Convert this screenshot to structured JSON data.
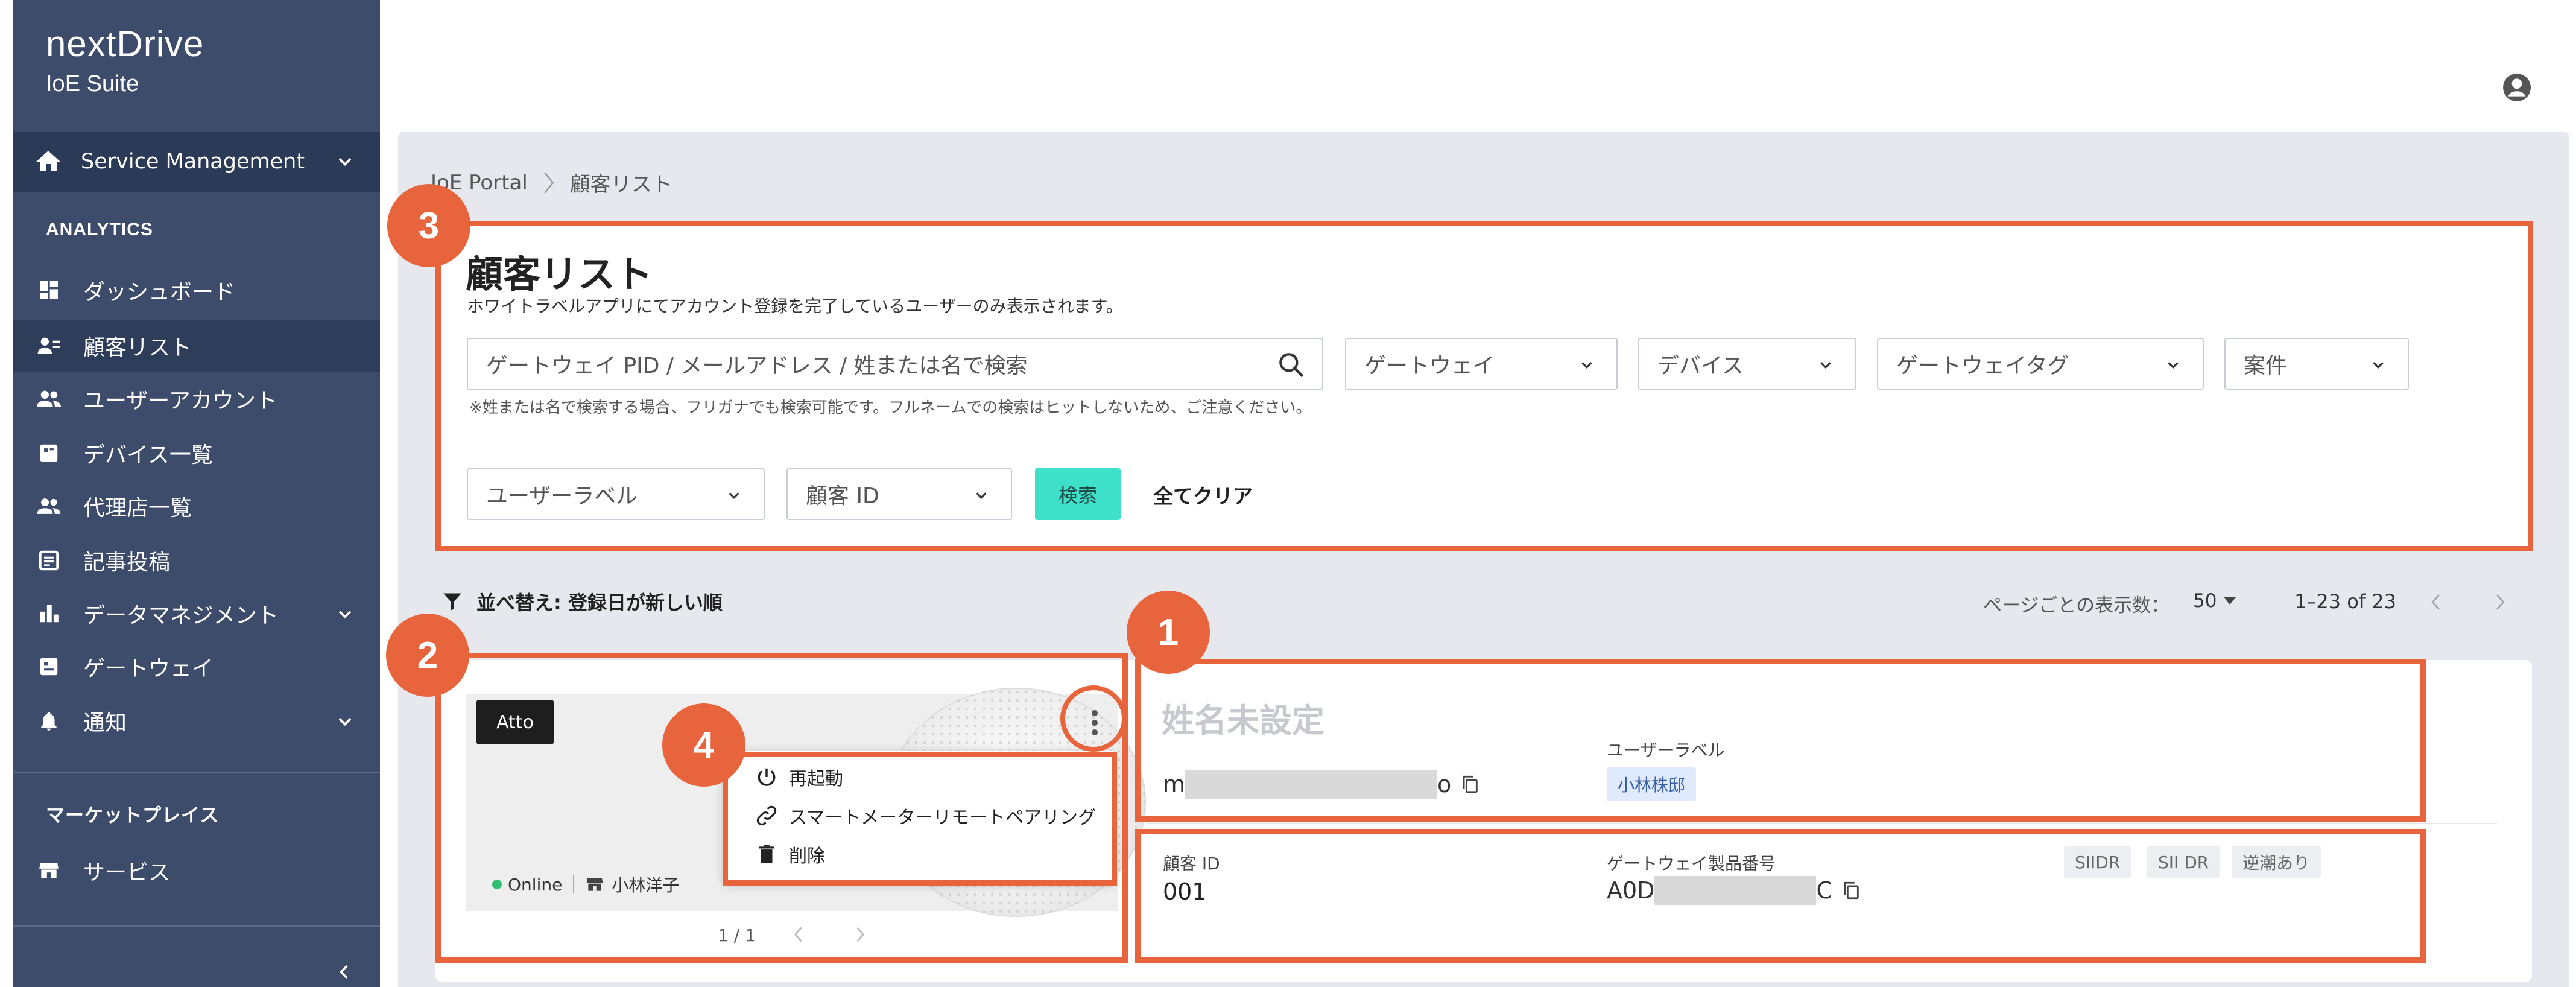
{
  "app": {
    "logo_name": "nextDrive",
    "logo_sub": "IoE Suite"
  },
  "sidebar": {
    "service": "Service Management",
    "analytics_heading": "ANALYTICS",
    "items": [
      {
        "label": "ダッシュボード"
      },
      {
        "label": "顧客リスト"
      },
      {
        "label": "ユーザーアカウント"
      },
      {
        "label": "デバイス一覧"
      },
      {
        "label": "代理店一覧"
      },
      {
        "label": "記事投稿"
      },
      {
        "label": "データマネジメント"
      },
      {
        "label": "ゲートウェイ"
      },
      {
        "label": "通知"
      }
    ],
    "marketplace_heading": "マーケットプレイス",
    "marketplace_items": [
      {
        "label": "サービス"
      }
    ]
  },
  "breadcrumb": {
    "root": "IoE Portal",
    "current": "顧客リスト"
  },
  "search": {
    "title": "顧客リスト",
    "description": "ホワイトラベルアプリにてアカウント登録を完了しているユーザーのみ表示されます。",
    "placeholder": "ゲートウェイ PID / メールアドレス / 姓または名で検索",
    "hint": "※姓または名で検索する場合、フリガナでも検索可能です。フルネームでの検索はヒットしないため、ご注意ください。",
    "filters": {
      "gateway": "ゲートウェイ",
      "device": "デバイス",
      "gateway_tag": "ゲートウェイタグ",
      "case": "案件",
      "user_label": "ユーザーラベル",
      "customer_id": "顧客 ID"
    },
    "search_button": "検索",
    "clear_button": "全てクリア"
  },
  "list": {
    "sort_label": "並べ替え: 登録日が新しい順",
    "per_page_label": "ページごとの表示数：",
    "per_page_value": "50",
    "range": "1–23 of 23"
  },
  "customer": {
    "model": "Atto",
    "status": "Online",
    "shop": "小林洋子",
    "carousel": "1 / 1",
    "name": "姓名未設定",
    "email_start": "m",
    "email_end": "o",
    "user_label_title": "ユーザーラベル",
    "user_label_value": "小林株邸",
    "customer_id_label": "顧客 ID",
    "customer_id_value": "001",
    "gateway_label": "ゲートウェイ製品番号",
    "gateway_start": "A0D",
    "gateway_end": "C",
    "tags": [
      "SIIDR",
      "SII DR",
      "逆潮あり"
    ]
  },
  "menu": {
    "items": [
      {
        "label": "再起動"
      },
      {
        "label": "スマートメーターリモートペアリング"
      },
      {
        "label": "削除"
      }
    ]
  },
  "annotations": [
    "1",
    "2",
    "3",
    "4"
  ],
  "colors": {
    "sidebar": "#3d4c6b",
    "accent": "#e8643c",
    "search_button": "#3ee0c9",
    "chip": "#dfeafd"
  }
}
